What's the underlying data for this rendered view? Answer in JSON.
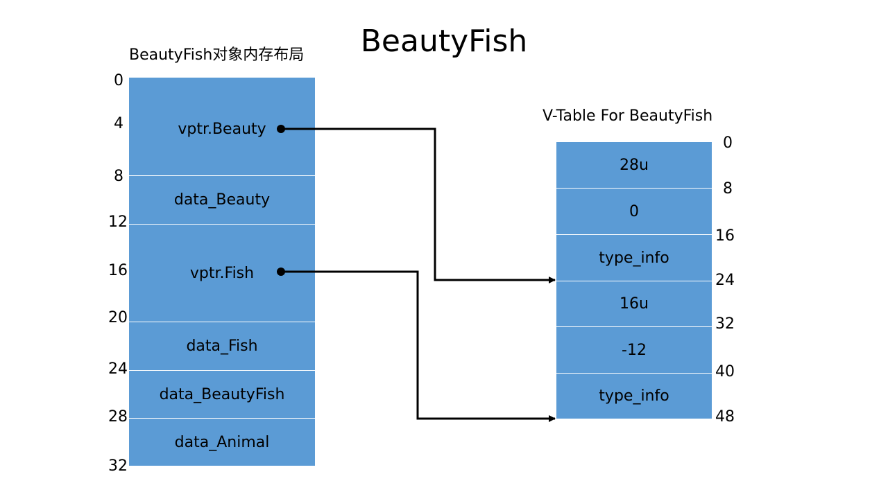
{
  "title": "BeautyFish",
  "object_layout": {
    "caption": "BeautyFish对象内存布局",
    "offsets": [
      "0",
      "4",
      "8",
      "12",
      "16",
      "20",
      "24",
      "28",
      "32"
    ],
    "blocks": [
      "vptr.Beauty",
      "data_Beauty",
      "vptr.Fish",
      "data_Fish",
      "data_BeautyFish",
      "data_Animal"
    ]
  },
  "vtable": {
    "caption": "V-Table For BeautyFish",
    "offsets": [
      "0",
      "8",
      "16",
      "24",
      "32",
      "40",
      "48"
    ],
    "entries": [
      "28u",
      "0",
      "type_info",
      "16u",
      "-12",
      "type_info"
    ]
  },
  "colors": {
    "block_fill": "#5b9bd5",
    "arrow": "#000000"
  }
}
